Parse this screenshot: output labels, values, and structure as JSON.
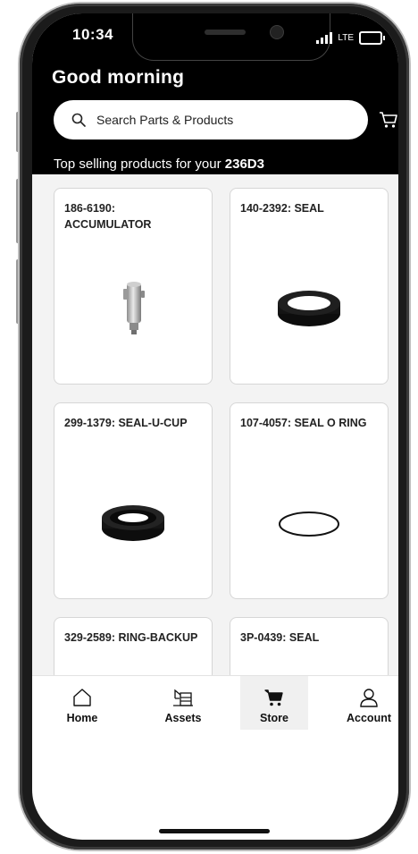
{
  "status_bar": {
    "time": "10:34",
    "network": "LTE"
  },
  "header": {
    "greeting": "Good morning",
    "search_placeholder": "Search Parts & Products",
    "subtitle_prefix": "Top selling products for your",
    "asset_model": "236D3"
  },
  "products": [
    {
      "title": "186-6190: ACCUMULATOR",
      "image": "accumulator"
    },
    {
      "title": "140-2392: SEAL",
      "image": "seal-ring"
    },
    {
      "title": "299-1379: SEAL-U-CUP",
      "image": "seal-u-cup"
    },
    {
      "title": "107-4057: SEAL O RING",
      "image": "o-ring"
    },
    {
      "title": "329-2589: RING-BACKUP",
      "image": "o-ring"
    },
    {
      "title": "3P-0439: SEAL",
      "image": "o-ring"
    }
  ],
  "nav": {
    "home": "Home",
    "assets": "Assets",
    "store": "Store",
    "account": "Account",
    "active": "store"
  }
}
